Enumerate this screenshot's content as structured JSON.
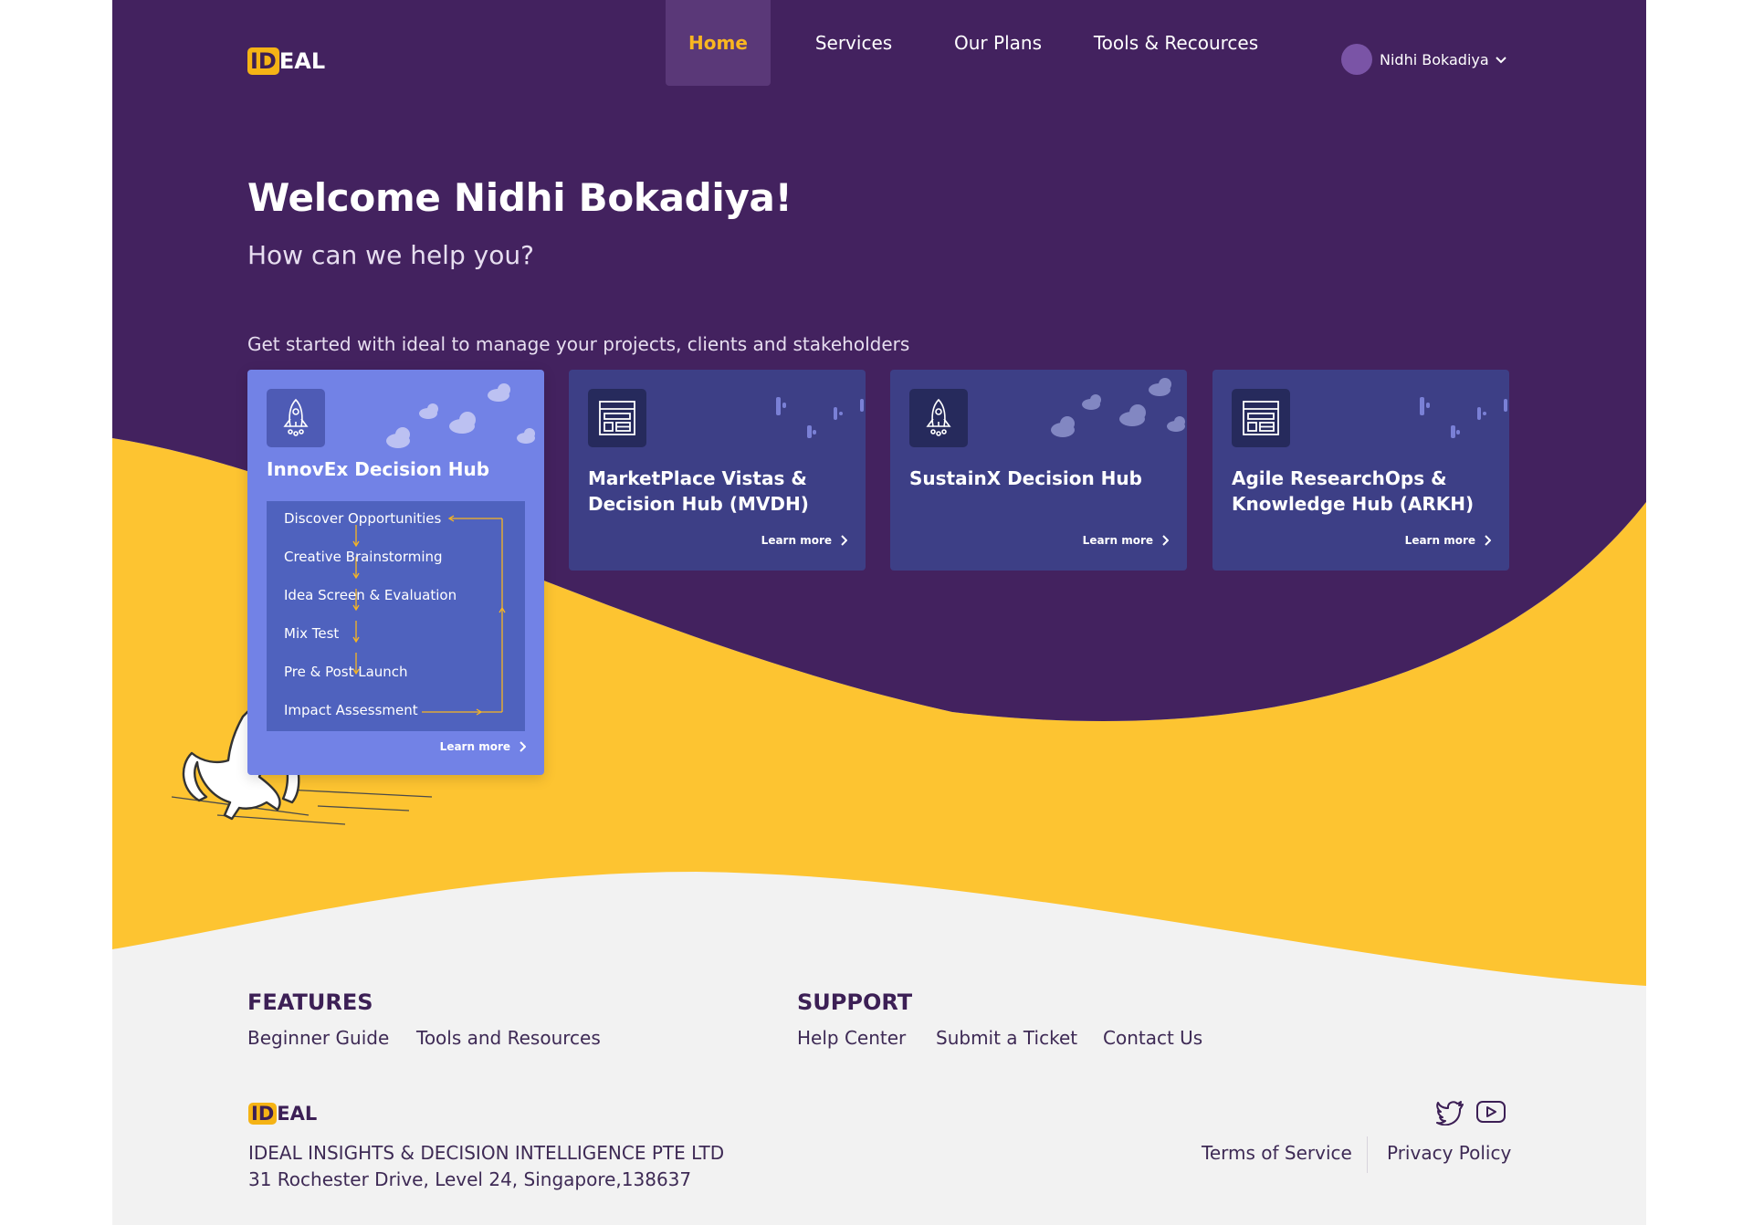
{
  "brand": {
    "logo_highlight": "ID",
    "logo_rest": "EAL"
  },
  "nav": {
    "items": [
      {
        "label": "Home",
        "active": true
      },
      {
        "label": "Services",
        "active": false
      },
      {
        "label": "Our Plans",
        "active": false
      },
      {
        "label": "Tools & Recources",
        "active": false
      }
    ],
    "user_name": "Nidhi Bokadiya"
  },
  "hero": {
    "title": "Welcome Nidhi Bokadiya!",
    "subtitle": "How can we help you?",
    "get_started": "Get started with ideal to manage your projects, clients and stakeholders"
  },
  "cards": [
    {
      "title": "InnovEx Decision Hub",
      "icon": "rocket-icon",
      "learn_more": "Learn more",
      "steps": [
        "Discover Opportunities",
        "Creative Brainstorming",
        "Idea Screen & Evaluation",
        "Mix Test",
        "Pre & Post Launch",
        "Impact Assessment"
      ]
    },
    {
      "title": "MarketPlace Vistas & Decision Hub (MVDH)",
      "icon": "layout-icon",
      "learn_more": "Learn more"
    },
    {
      "title": "SustainX Decision Hub",
      "icon": "rocket-icon",
      "learn_more": "Learn more"
    },
    {
      "title": "Agile  ResearchOps & Knowledge Hub (ARKH)",
      "icon": "layout-icon",
      "learn_more": "Learn more"
    }
  ],
  "footer": {
    "features": {
      "heading": "FEATURES",
      "links": [
        "Beginner Guide",
        "Tools and Resources"
      ]
    },
    "support": {
      "heading": "SUPPORT",
      "links": [
        "Help Center",
        "Submit a Ticket",
        "Contact Us"
      ]
    },
    "company_name": "IDEAL INSIGHTS & DECISION INTELLIGENCE PTE LTD",
    "address": "31 Rochester Drive, Level 24, Singapore,138637",
    "legal": [
      "Terms of Service",
      "Privacy Policy"
    ],
    "social": [
      "twitter-icon",
      "youtube-icon"
    ]
  },
  "colors": {
    "purple": "#43225f",
    "yellow": "#fdc431",
    "accent": "#f9b620",
    "card_dark": "#3d3f86",
    "card_active": "#7282e6"
  }
}
